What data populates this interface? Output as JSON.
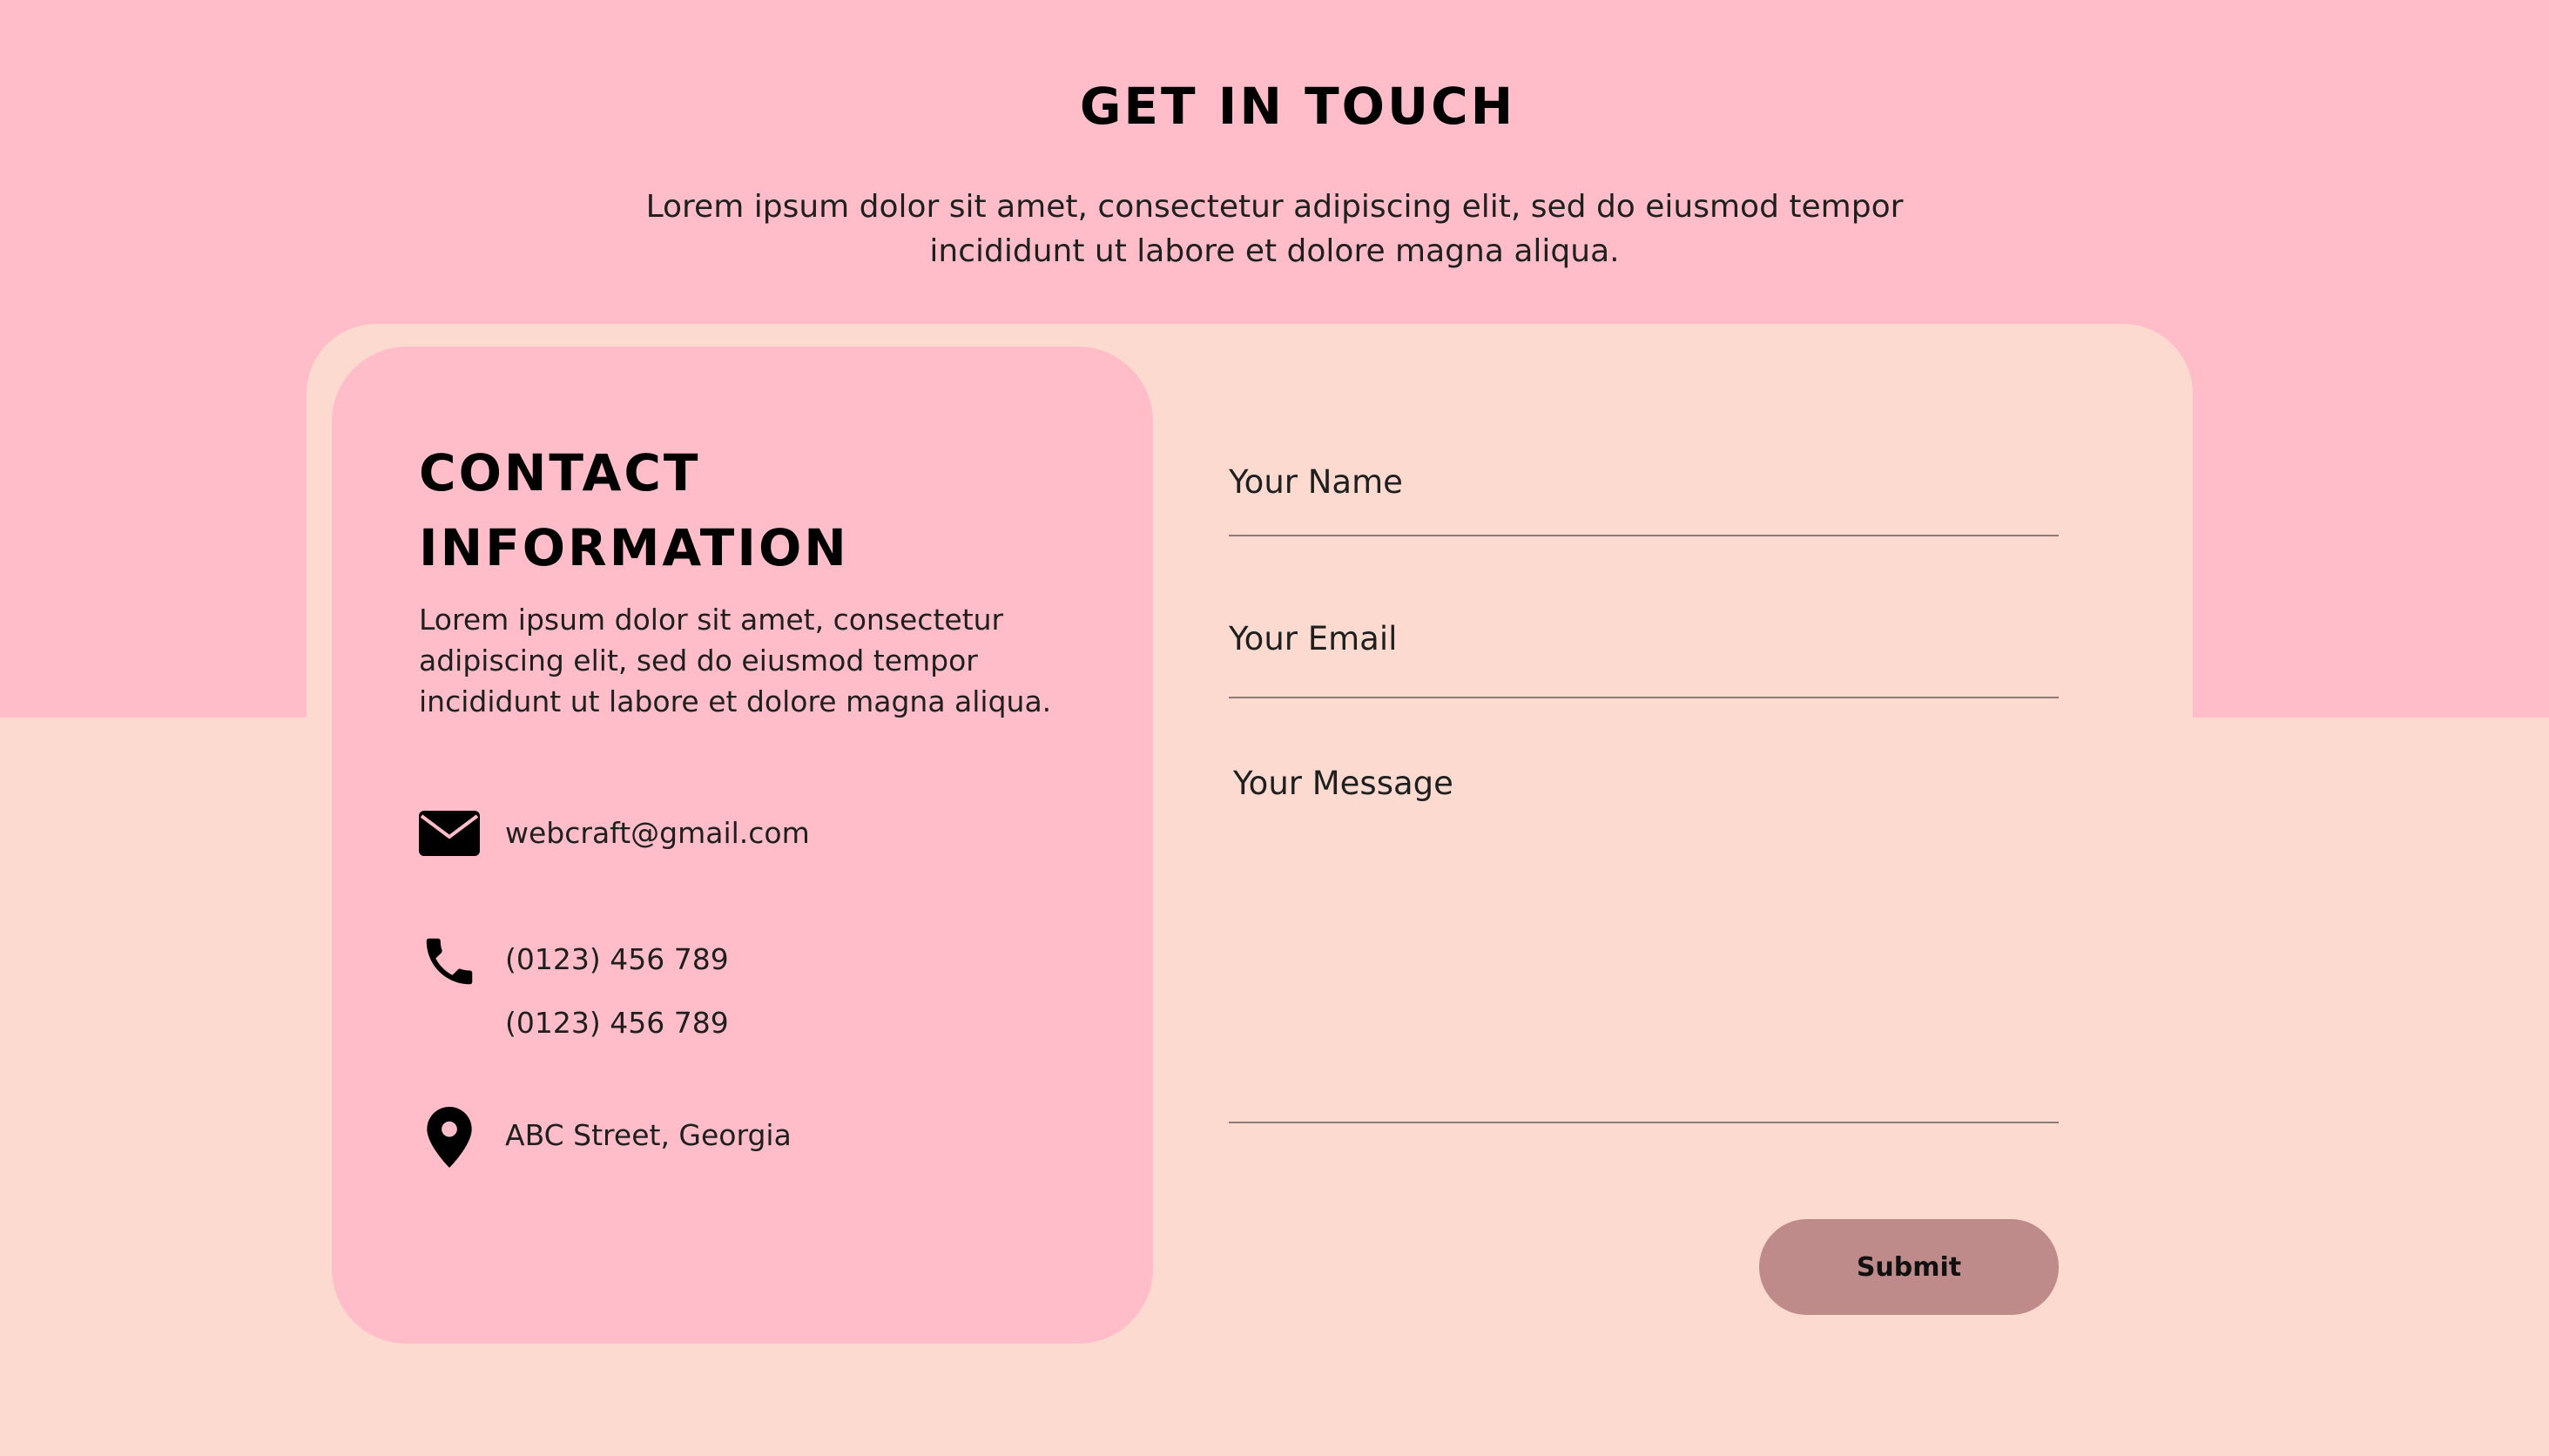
{
  "header": {
    "title": "GET IN TOUCH",
    "subtitle": "Lorem ipsum dolor sit amet, consectetur adipiscing elit, sed do eiusmod tempor incididunt ut labore et dolore magna aliqua."
  },
  "info": {
    "title_line1": "CONTACT",
    "title_line2": "INFORMATION",
    "description": "Lorem ipsum dolor sit amet, consectetur adipiscing elit, sed do eiusmod tempor incididunt ut labore et dolore magna aliqua.",
    "email": {
      "icon": "envelope-icon",
      "value": "webcraft@gmail.com"
    },
    "phone": {
      "icon": "phone-icon",
      "values": [
        "(0123) 456 789",
        "(0123) 456 789"
      ]
    },
    "address": {
      "icon": "location-pin-icon",
      "value": "ABC Street, Georgia"
    }
  },
  "form": {
    "name_label": "Your Name",
    "email_label": "Your Email",
    "message_label": "Your Message",
    "submit_label": "Submit"
  },
  "colors": {
    "top_band": "#FEBDC8",
    "background": "#FDDAD0",
    "info_card": "#FEBDC8",
    "submit_button": "#BF8A8A"
  }
}
